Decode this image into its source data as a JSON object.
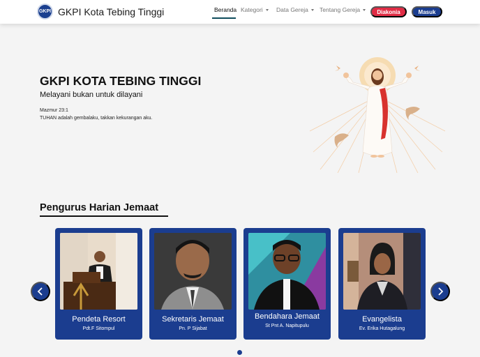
{
  "navbar": {
    "brand_name": "GKPI Kota Tebing Tinggi",
    "logo_icon": "church-logo-icon",
    "links": [
      {
        "label": "Beranda",
        "active": true
      },
      {
        "label": "Kategori",
        "dropdown": true
      },
      {
        "label": "Data Gereja",
        "dropdown": true
      },
      {
        "label": "Tentang Gereja",
        "dropdown": true
      }
    ],
    "diakonia_label": "Diakonia",
    "masuk_label": "Masuk"
  },
  "hero": {
    "title": "GKPI KOTA TEBING TINGGI",
    "subtitle": "Melayani bukan untuk dilayani",
    "verse_ref": "Mazmur 23:1",
    "verse_text": "TUHAN adalah gembalaku, takkan kekurangan aku.",
    "illustration": "jesus-illustration"
  },
  "section": {
    "title": "Pengurus Harian Jemaat",
    "cards": [
      {
        "role": "Pendeta Resort",
        "name": "Pdt.F Sitompul"
      },
      {
        "role": "Sekretaris Jemaat",
        "name": "Pn. P Sijabat"
      },
      {
        "role": "Bendahara Jemaat",
        "name": "St Pnt A. Napitupulu"
      },
      {
        "role": "Evangelista",
        "name": "Ev. Erika Hutagalung"
      }
    ]
  },
  "colors": {
    "primary": "#1b3d8f",
    "danger": "#e02c45",
    "nav_active_underline": "#0f4c5c"
  }
}
